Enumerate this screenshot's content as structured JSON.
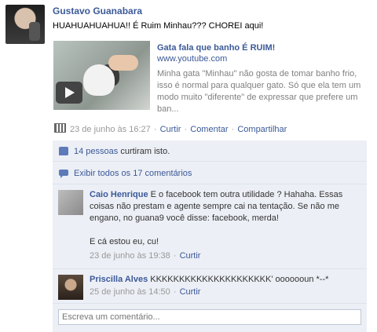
{
  "post": {
    "author": "Gustavo Guanabara",
    "message": "HUAHUAHUAHUA!! É Ruim Minhau??? CHOREI aqui!",
    "link": {
      "title": "Gata fala que banho É RUIM!",
      "url": "www.youtube.com",
      "description": "Minha gata \"Minhau\" não gosta de tomar banho frio, isso é normal para qualquer gato. Só que ela tem um modo muito \"diferente\" de expressar que prefere um ban..."
    },
    "meta": {
      "timestamp": "23 de junho às 16:27",
      "sep": "·",
      "curtir": "Curtir",
      "comentar": "Comentar",
      "compartilhar": "Compartilhar"
    }
  },
  "ufi": {
    "likes_link": "14 pessoas",
    "likes_rest": " curtiram isto.",
    "show_all": "Exibir todos os 17 comentários",
    "comments": [
      {
        "author": "Caio Henrique",
        "text": "E o facebook tem outra utilidade ? Hahaha. Essas coisas não prestam e agente sempre cai na tentação. Se não me engano, no guana9 você disse: facebook, merda!",
        "text2": "E cá estou eu, cu!",
        "timestamp": "23 de junho às 19:38",
        "sep": "·",
        "like": "Curtir"
      },
      {
        "author": "Priscilla Alves",
        "text": "KKKKKKKKKKKKKKKKKKKKK' ooooooun *--*",
        "timestamp": "25 de junho às 14:50",
        "sep": "·",
        "like": "Curtir"
      }
    ],
    "write_placeholder": "Escreva um comentário..."
  }
}
